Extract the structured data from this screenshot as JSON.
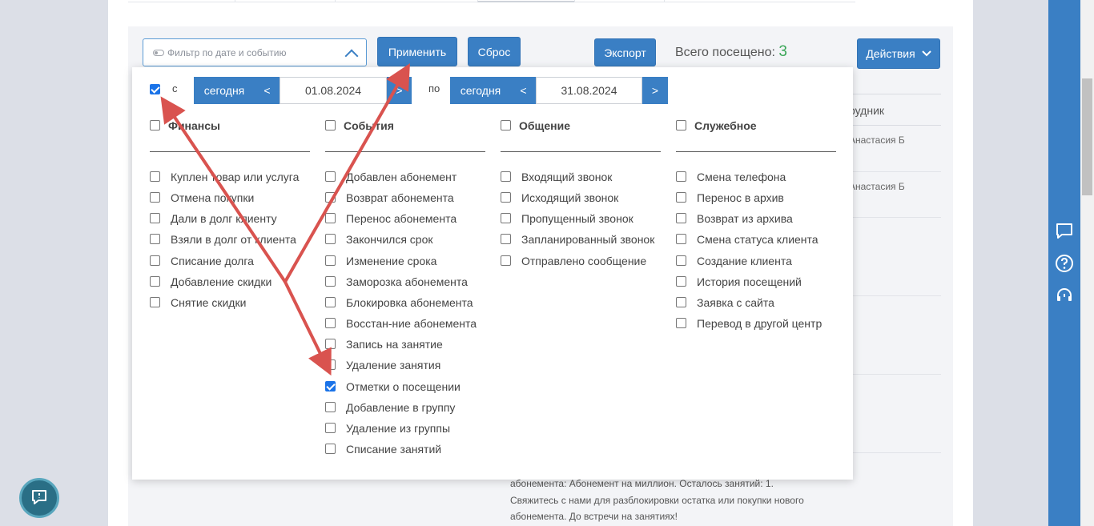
{
  "toolbar": {
    "filter_placeholder": "Фильтр по дате и событию",
    "apply_label": "Применить",
    "reset_label": "Сброс",
    "export_label": "Экспорт",
    "total_label": "Всего посещено:",
    "total_count": "3",
    "actions_label": "Действия"
  },
  "table_bg": {
    "header": "рудник",
    "rows": [
      "Анастасия Б",
      "Анастасия Б"
    ]
  },
  "message_text": [
    "абонемента: Абонемент на миллион. Осталось занятий: 1.",
    "Свяжитесь с нами для разблокировки остатка или покупки нового",
    "абонемента. До встречи на занятиях!"
  ],
  "date_range": {
    "from_label": "с",
    "from_checked": true,
    "from_today": "сегодня",
    "from_date": "01.08.2024",
    "to_label": "по",
    "to_today": "сегодня",
    "to_date": "31.08.2024",
    "prev": "<",
    "next": ">"
  },
  "categories": [
    {
      "title": "Финансы",
      "items": [
        {
          "label": "Куплен товар или услуга",
          "checked": false
        },
        {
          "label": "Отмена покупки",
          "checked": false
        },
        {
          "label": "Дали в долг клиенту",
          "checked": false
        },
        {
          "label": "Взяли в долг от клиента",
          "checked": false
        },
        {
          "label": "Списание долга",
          "checked": false
        },
        {
          "label": "Добавление скидки",
          "checked": false
        },
        {
          "label": "Снятие скидки",
          "checked": false
        }
      ]
    },
    {
      "title": "События",
      "items": [
        {
          "label": "Добавлен абонемент",
          "checked": false
        },
        {
          "label": "Возврат абонемента",
          "checked": false
        },
        {
          "label": "Перенос абонемента",
          "checked": false
        },
        {
          "label": "Закончился срок",
          "checked": false
        },
        {
          "label": "Изменение срока",
          "checked": false
        },
        {
          "label": "Заморозка абонемента",
          "checked": false
        },
        {
          "label": "Блокировка абонемента",
          "checked": false
        },
        {
          "label": "Восстан-ние абонемента",
          "checked": false
        },
        {
          "label": "Запись на занятие",
          "checked": false
        },
        {
          "label": "Удаление занятия",
          "checked": false
        },
        {
          "label": "Отметки о посещении",
          "checked": true
        },
        {
          "label": "Добавление в группу",
          "checked": false
        },
        {
          "label": "Удаление из группы",
          "checked": false
        },
        {
          "label": "Списание занятий",
          "checked": false
        }
      ]
    },
    {
      "title": "Общение",
      "items": [
        {
          "label": "Входящий звонок",
          "checked": false
        },
        {
          "label": "Исходящий звонок",
          "checked": false
        },
        {
          "label": "Пропущенный звонок",
          "checked": false
        },
        {
          "label": "Запланированный звонок",
          "checked": false
        },
        {
          "label": "Отправлено сообщение",
          "checked": false
        }
      ]
    },
    {
      "title": "Служебное",
      "items": [
        {
          "label": "Смена телефона",
          "checked": false
        },
        {
          "label": "Перенос в архив",
          "checked": false
        },
        {
          "label": "Возврат из архива",
          "checked": false
        },
        {
          "label": "Смена статуса клиента",
          "checked": false
        },
        {
          "label": "Создание клиента",
          "checked": false
        },
        {
          "label": "История посещений",
          "checked": false
        },
        {
          "label": "Заявка с сайта",
          "checked": false
        },
        {
          "label": "Перевод в другой центр",
          "checked": false
        }
      ]
    }
  ],
  "sidebar_icons": [
    "chat-icon",
    "help-icon",
    "support-headset-icon"
  ],
  "colors": {
    "primary": "#3a7fc4",
    "count_green": "#3aa657",
    "annotation_arrow": "#d9534f"
  }
}
